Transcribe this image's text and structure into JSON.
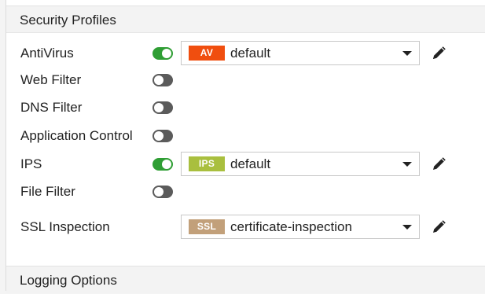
{
  "security_profiles": {
    "header": "Security Profiles",
    "rows": [
      {
        "label": "AntiVirus",
        "enabled": true,
        "profile": {
          "badge": "AV",
          "badge_color": "#f04e0f",
          "value": "default"
        }
      },
      {
        "label": "Web Filter",
        "enabled": false
      },
      {
        "label": "DNS Filter",
        "enabled": false
      },
      {
        "label": "Application Control",
        "enabled": false
      },
      {
        "label": "IPS",
        "enabled": true,
        "profile": {
          "badge": "IPS",
          "badge_color": "#a9bf3e",
          "value": "default"
        }
      },
      {
        "label": "File Filter",
        "enabled": false
      },
      {
        "label": "SSL Inspection",
        "profile": {
          "badge": "SSL",
          "badge_color": "#c2a07a",
          "value": "certificate-inspection"
        }
      }
    ]
  },
  "logging_options": {
    "header": "Logging Options"
  },
  "colors": {
    "toggle_on": "#2f9e34",
    "toggle_off": "#5b5b5b"
  },
  "icons": {
    "edit": "pencil-icon",
    "dropdown": "chevron-down-icon"
  }
}
